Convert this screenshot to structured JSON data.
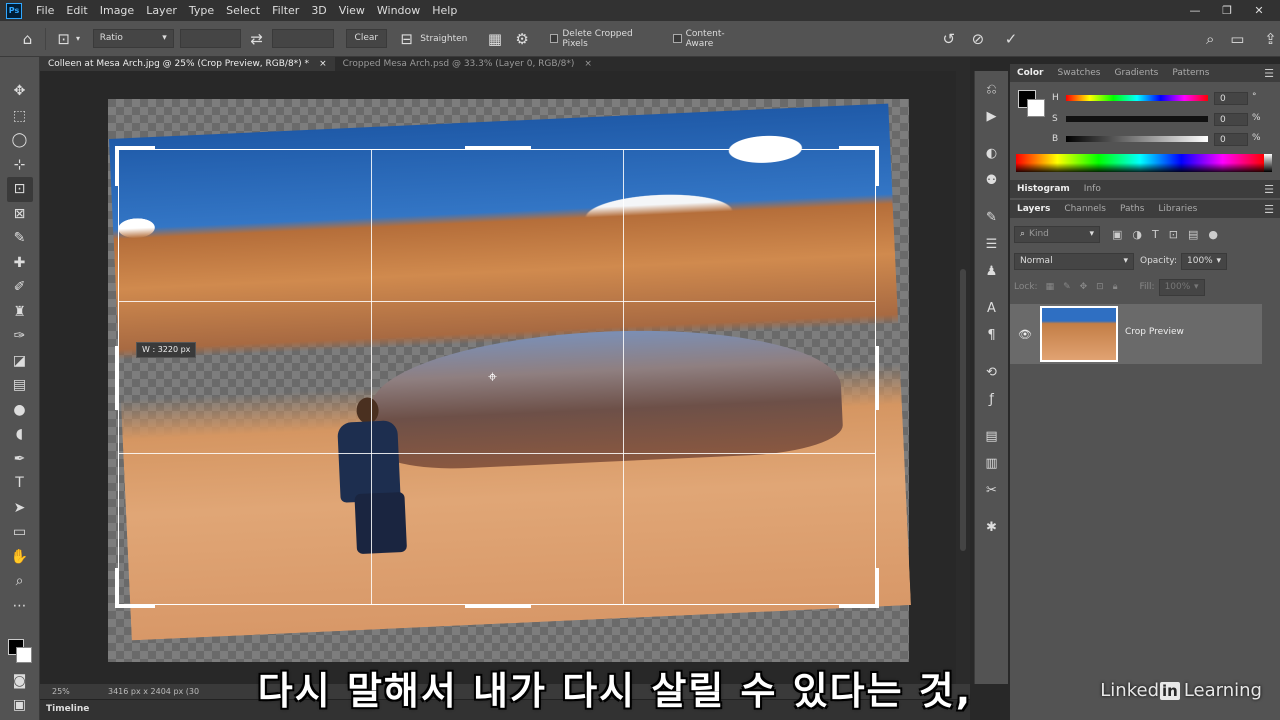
{
  "menu": {
    "logo": "Ps",
    "items": [
      "File",
      "Edit",
      "Image",
      "Layer",
      "Type",
      "Select",
      "Filter",
      "3D",
      "View",
      "Window",
      "Help"
    ]
  },
  "options": {
    "ratio": "Ratio",
    "clear": "Clear",
    "straighten": "Straighten",
    "delete_cropped": "Delete Cropped Pixels",
    "content_aware": "Content-Aware"
  },
  "tabs": [
    {
      "label": "Colleen at Mesa Arch.jpg @ 25% (Crop Preview, RGB/8*) *",
      "close": "×"
    },
    {
      "label": "Cropped Mesa Arch.psd @ 33.3% (Layer 0, RGB/8*)",
      "close": "×"
    }
  ],
  "canvas": {
    "width_tooltip": "W :  3220 px",
    "status_zoom": "25%",
    "status_info": "3416 px x 2404 px (30"
  },
  "timeline": "Timeline",
  "color_panel": {
    "tabs": [
      "Color",
      "Swatches",
      "Gradients",
      "Patterns"
    ],
    "h_label": "H",
    "s_label": "S",
    "b_label": "B",
    "h_value": "0",
    "s_value": "0",
    "b_value": "0",
    "h_unit": "°",
    "s_unit": "%",
    "b_unit": "%"
  },
  "histogram_tabs": [
    "Histogram",
    "Info"
  ],
  "layers_panel": {
    "tabs": [
      "Layers",
      "Channels",
      "Paths",
      "Libraries"
    ],
    "kind": "Kind",
    "blend_mode": "Normal",
    "opacity_label": "Opacity:",
    "opacity_value": "100%",
    "lock_label": "Lock:",
    "fill_label": "Fill:",
    "fill_value": "100%",
    "layer_name": "Crop Preview"
  },
  "subtitle": "다시 말해서 내가 다시 살릴 수 있다는 것,",
  "watermark": {
    "left": "Linked",
    "in": "in",
    "right": "Learning"
  }
}
